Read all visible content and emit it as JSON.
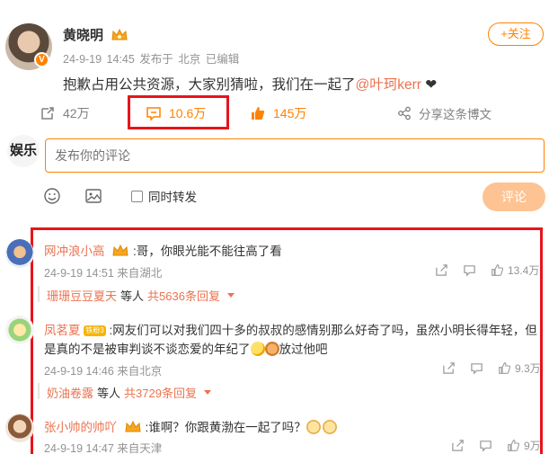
{
  "post": {
    "author": "黄晓明",
    "meta": "24-9-19 14:45 发布于 北京  已编辑",
    "follow_label": "+关注",
    "text_prefix": "抱歉占用公共资源，大家别猜啦，我们在一起了",
    "mention": "@叶珂kerr",
    "text_suffix": " ❤",
    "verified_badge": "V"
  },
  "actions": {
    "repost_count": "42万",
    "comment_count": "10.6万",
    "like_count": "145万",
    "share_label": "分享这条博文"
  },
  "compose": {
    "avatar_text": "娱乐",
    "placeholder": "发布你的评论",
    "repost_label": "同时转发",
    "submit_label": "评论"
  },
  "comments": [
    {
      "name": "网冲浪小高",
      "text": ":哥，你眼光能不能往高了看",
      "text2": "",
      "meta": "24-9-19 14:51 来自湖北",
      "likes": "13.4万",
      "reply_user": "珊珊豆豆夏天",
      "reply_mid": "等人",
      "reply_count": "共5636条回复"
    },
    {
      "name": "凤茗夏",
      "badge": "铁粉3",
      "text": ":网友们可以对我们四十多的叔叔的感情别那么好奇了吗，虽然小明长得年轻，但",
      "text2": "是真的不是被审判谈不谈恋爱的年纪了",
      "text2_tail": "放过他吧",
      "meta": "24-9-19 14:46 来自北京",
      "likes": "9.3万",
      "reply_user": "奶油卷露",
      "reply_mid": "等人",
      "reply_count": "共3729条回复"
    },
    {
      "name": "张小帅的帅吖",
      "text": ":谁啊？你跟黄渤在一起了吗？",
      "text2": "",
      "meta": "24-9-19 14:47 来自天津",
      "likes": "9万"
    }
  ],
  "colors": {
    "brand_orange": "#ff8200",
    "link": "#eb7350",
    "highlight_red": "#e8141c"
  }
}
